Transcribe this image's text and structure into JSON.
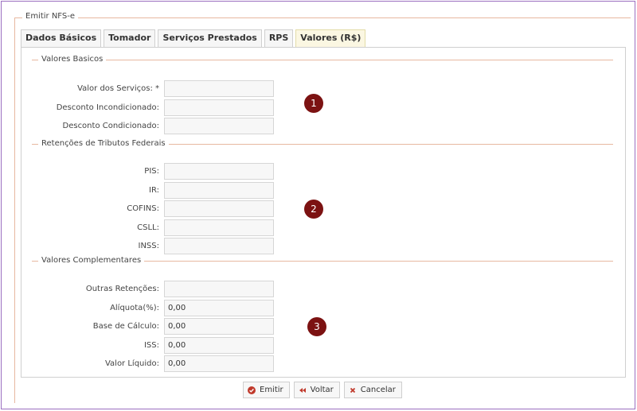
{
  "form": {
    "legend": "Emitir NFS-e"
  },
  "tabs": [
    {
      "label": "Dados Básicos"
    },
    {
      "label": "Tomador"
    },
    {
      "label": "Serviços Prestados"
    },
    {
      "label": "RPS"
    },
    {
      "label": "Valores (R$)",
      "active": true
    }
  ],
  "sections": {
    "basicos": {
      "legend": "Valores Basicos",
      "badge": "1",
      "fields": [
        {
          "label": "Valor dos Serviços: *",
          "value": ""
        },
        {
          "label": "Desconto Incondicionado:",
          "value": ""
        },
        {
          "label": "Desconto Condicionado:",
          "value": ""
        }
      ]
    },
    "retencoes": {
      "legend": "Retenções de Tributos Federais",
      "badge": "2",
      "fields": [
        {
          "label": "PIS:",
          "value": ""
        },
        {
          "label": "IR:",
          "value": ""
        },
        {
          "label": "COFINS:",
          "value": ""
        },
        {
          "label": "CSLL:",
          "value": ""
        },
        {
          "label": "INSS:",
          "value": ""
        }
      ]
    },
    "complementares": {
      "legend": "Valores Complementares",
      "badge": "3",
      "fields": [
        {
          "label": "Outras Retenções:",
          "value": ""
        },
        {
          "label": "Alíquota(%):",
          "value": "0,00"
        },
        {
          "label": "Base de Cálculo:",
          "value": "0,00"
        },
        {
          "label": "ISS:",
          "value": "0,00"
        },
        {
          "label": "Valor Líquido:",
          "value": "0,00"
        }
      ]
    }
  },
  "buttons": {
    "emitir": {
      "label": "Emitir",
      "icon": "check-circle-icon",
      "color": "#c0392b"
    },
    "voltar": {
      "label": "Voltar",
      "icon": "rewind-icon",
      "color": "#c0392b"
    },
    "cancelar": {
      "label": "Cancelar",
      "icon": "close-icon",
      "color": "#c0392b"
    }
  },
  "colors": {
    "badge": "#7c1212",
    "frame": "#9b6fc0",
    "legend_line": "#e7b8a0",
    "active_tab": "#fbf7e2"
  }
}
